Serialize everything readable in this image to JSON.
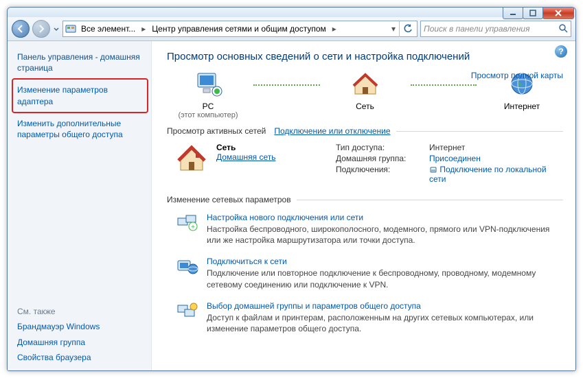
{
  "titlebar": {
    "min_tip": "Свернуть",
    "max_tip": "Развернуть",
    "close_tip": "Закрыть"
  },
  "toolbar": {
    "back_tip": "Назад",
    "fwd_tip": "Вперёд",
    "crumb1": "Все элемент...",
    "crumb2": "Центр управления сетями и общим доступом",
    "refresh_tip": "Обновить",
    "search_placeholder": "Поиск в панели управления"
  },
  "sidebar": {
    "home": "Панель управления - домашняя страница",
    "adapter": "Изменение параметров адаптера",
    "adv": "Изменить дополнительные параметры общего доступа",
    "seealso_h": "См. также",
    "firewall": "Брандмауэр Windows",
    "homegroup": "Домашняя группа",
    "browser": "Свойства браузера"
  },
  "main": {
    "title": "Просмотр основных сведений о сети и настройка подключений",
    "full_map": "Просмотр полной карты",
    "node_pc": "PC",
    "node_pc_sub": "(этот компьютер)",
    "node_net": "Сеть",
    "node_inet": "Интернет",
    "active_h": "Просмотр активных сетей",
    "active_link": "Подключение или отключение",
    "net_name": "Сеть",
    "net_type": "Домашняя сеть",
    "kv": {
      "k1": "Тип доступа:",
      "v1": "Интернет",
      "k2": "Домашняя группа:",
      "v2": "Присоединен",
      "k3": "Подключения:",
      "v3": "Подключение по локальной сети"
    },
    "settings_h": "Изменение сетевых параметров",
    "task1_t": "Настройка нового подключения или сети",
    "task1_d": "Настройка беспроводного, широкополосного, модемного, прямого или VPN-подключения или же настройка маршрутизатора или точки доступа.",
    "task2_t": "Подключиться к сети",
    "task2_d": "Подключение или повторное подключение к беспроводному, проводному, модемному сетевому соединению или подключение к VPN.",
    "task3_t": "Выбор домашней группы и параметров общего доступа",
    "task3_d": "Доступ к файлам и принтерам, расположенным на других сетевых компьютерах, или изменение параметров общего доступа."
  }
}
